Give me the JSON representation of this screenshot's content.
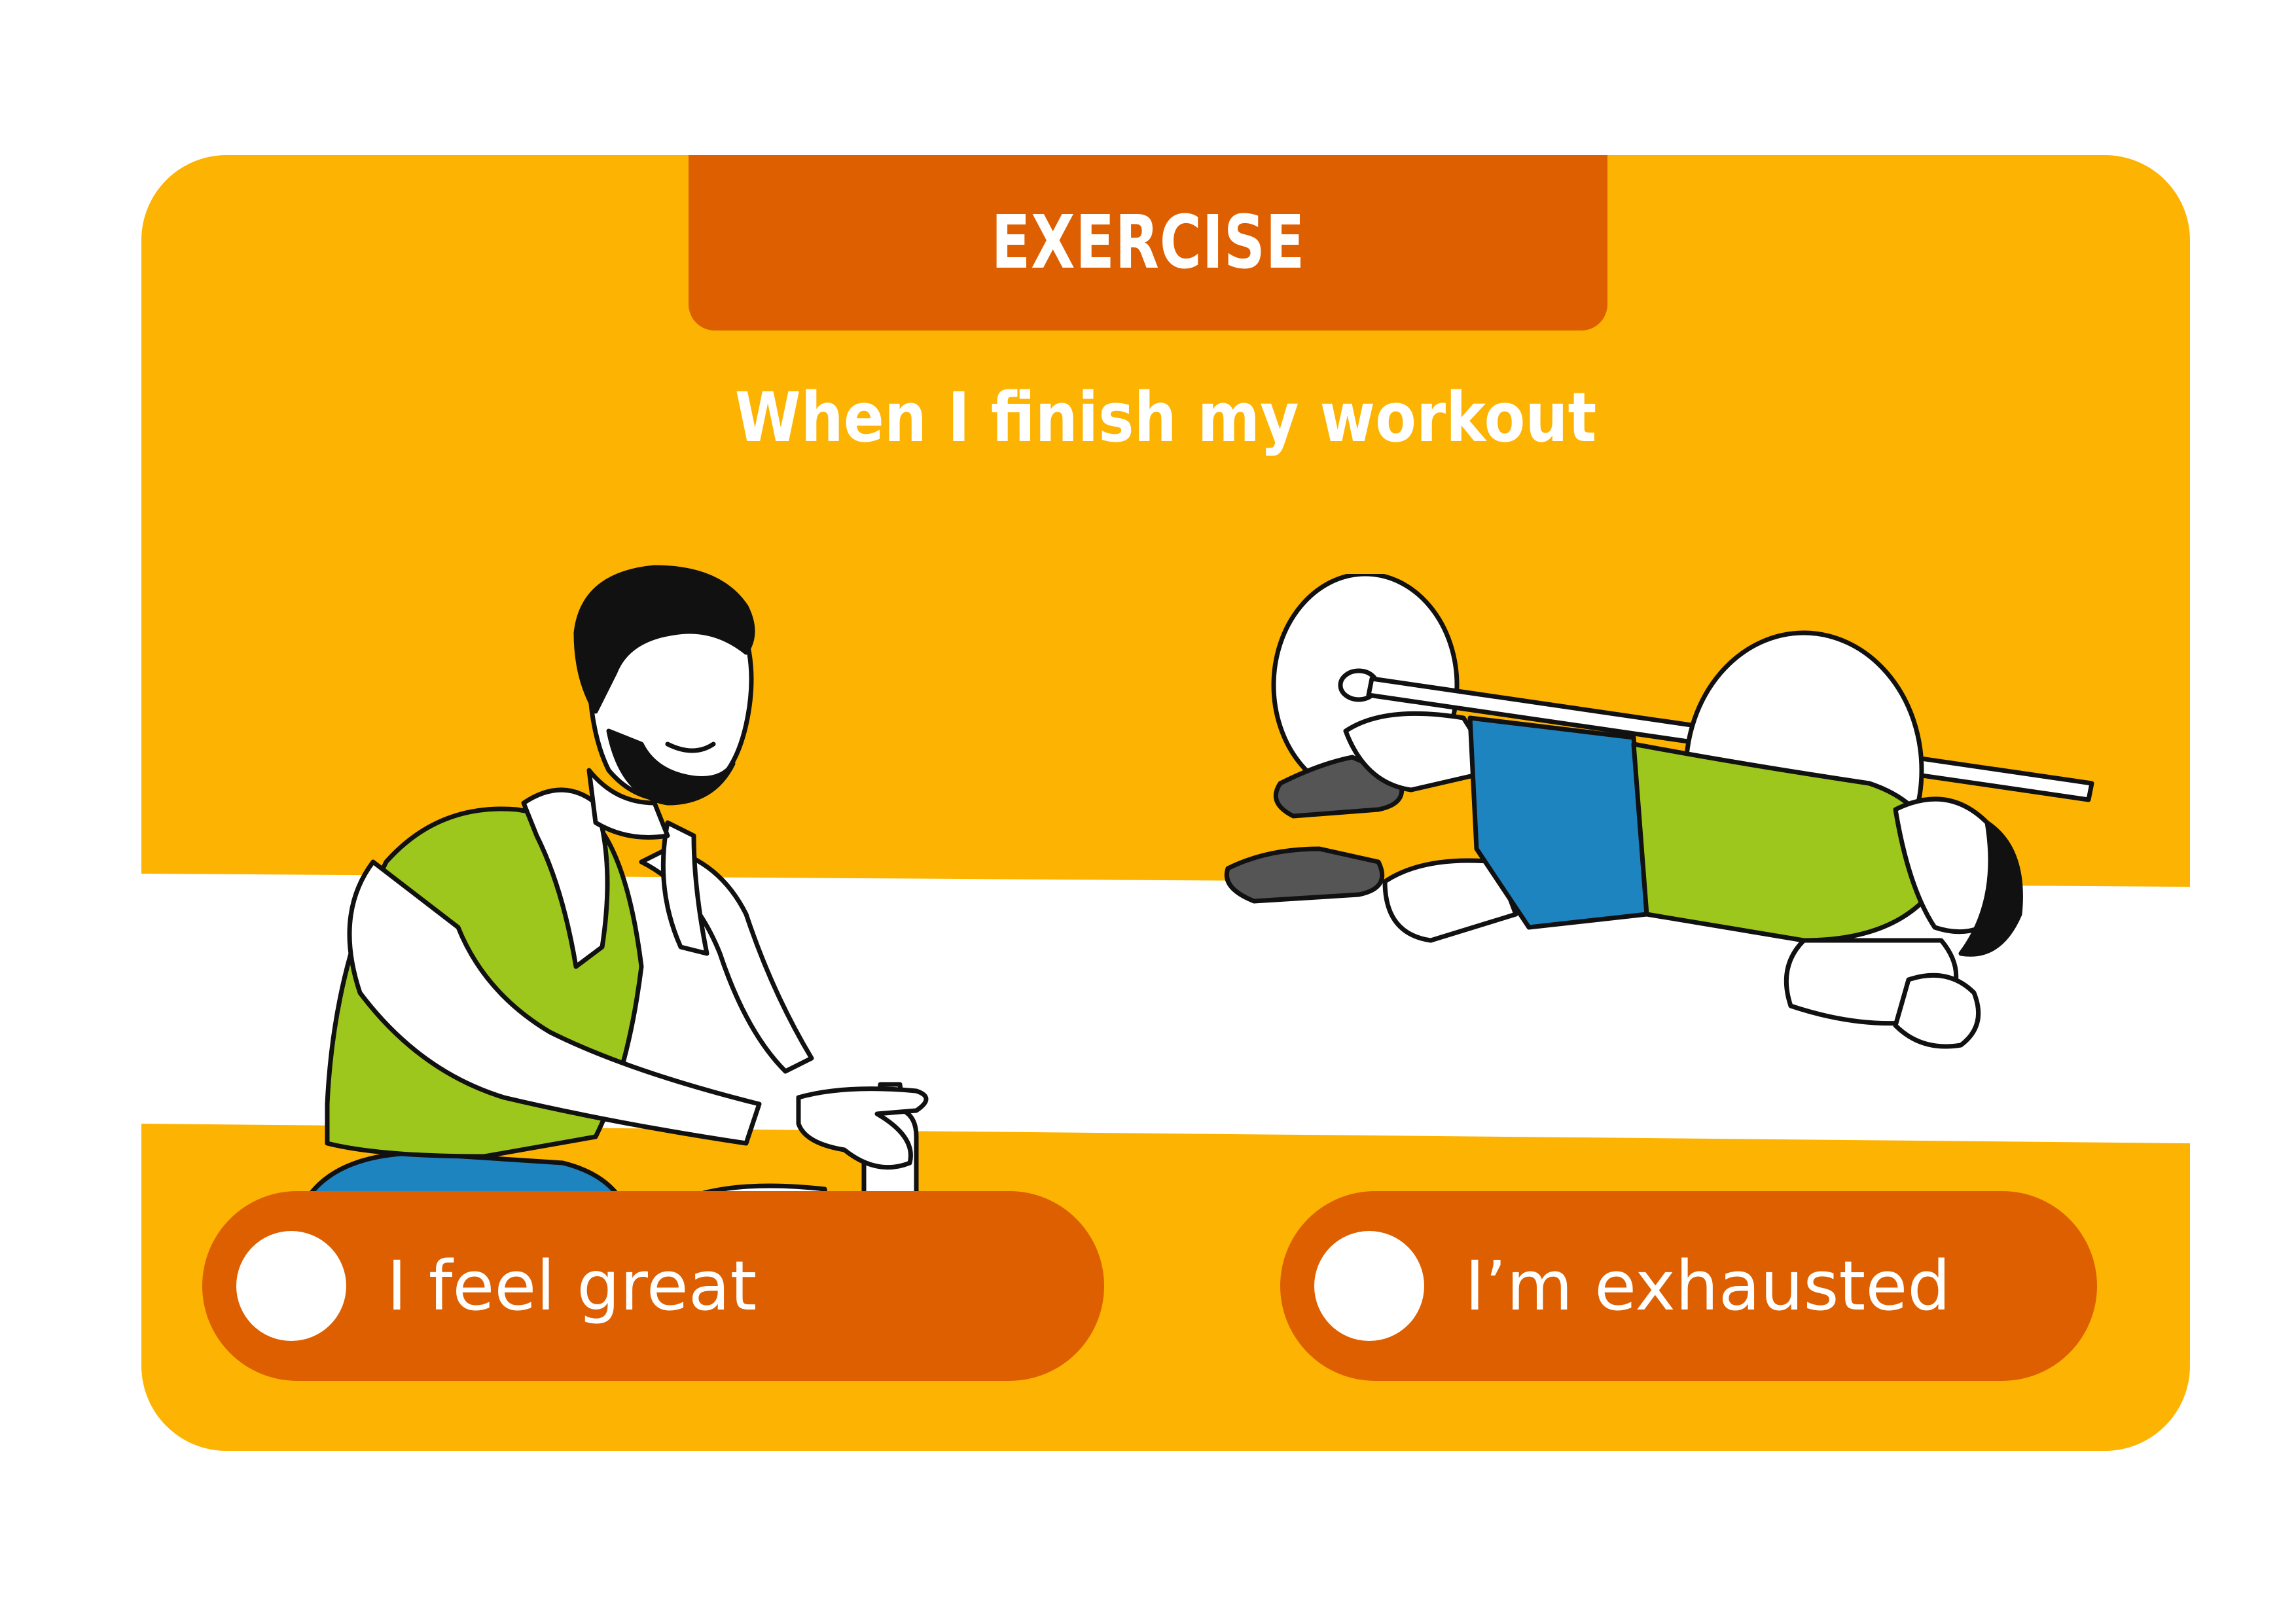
{
  "header": {
    "title": "EXERCISE"
  },
  "question": {
    "text": "When I finish my workout"
  },
  "illustrations": {
    "left": {
      "icon": "man-resting-with-water-bottle"
    },
    "right": {
      "icon": "man-collapsed-under-barbell"
    }
  },
  "options": [
    {
      "label": "I feel great",
      "selected": false
    },
    {
      "label": "I’m exhausted",
      "selected": false
    }
  ],
  "colors": {
    "card": "#fdb302",
    "accent": "#de5f00",
    "text": "#ffffff",
    "shirt": "#9ec71d",
    "shorts": "#1e84c0",
    "outline": "#111111"
  }
}
